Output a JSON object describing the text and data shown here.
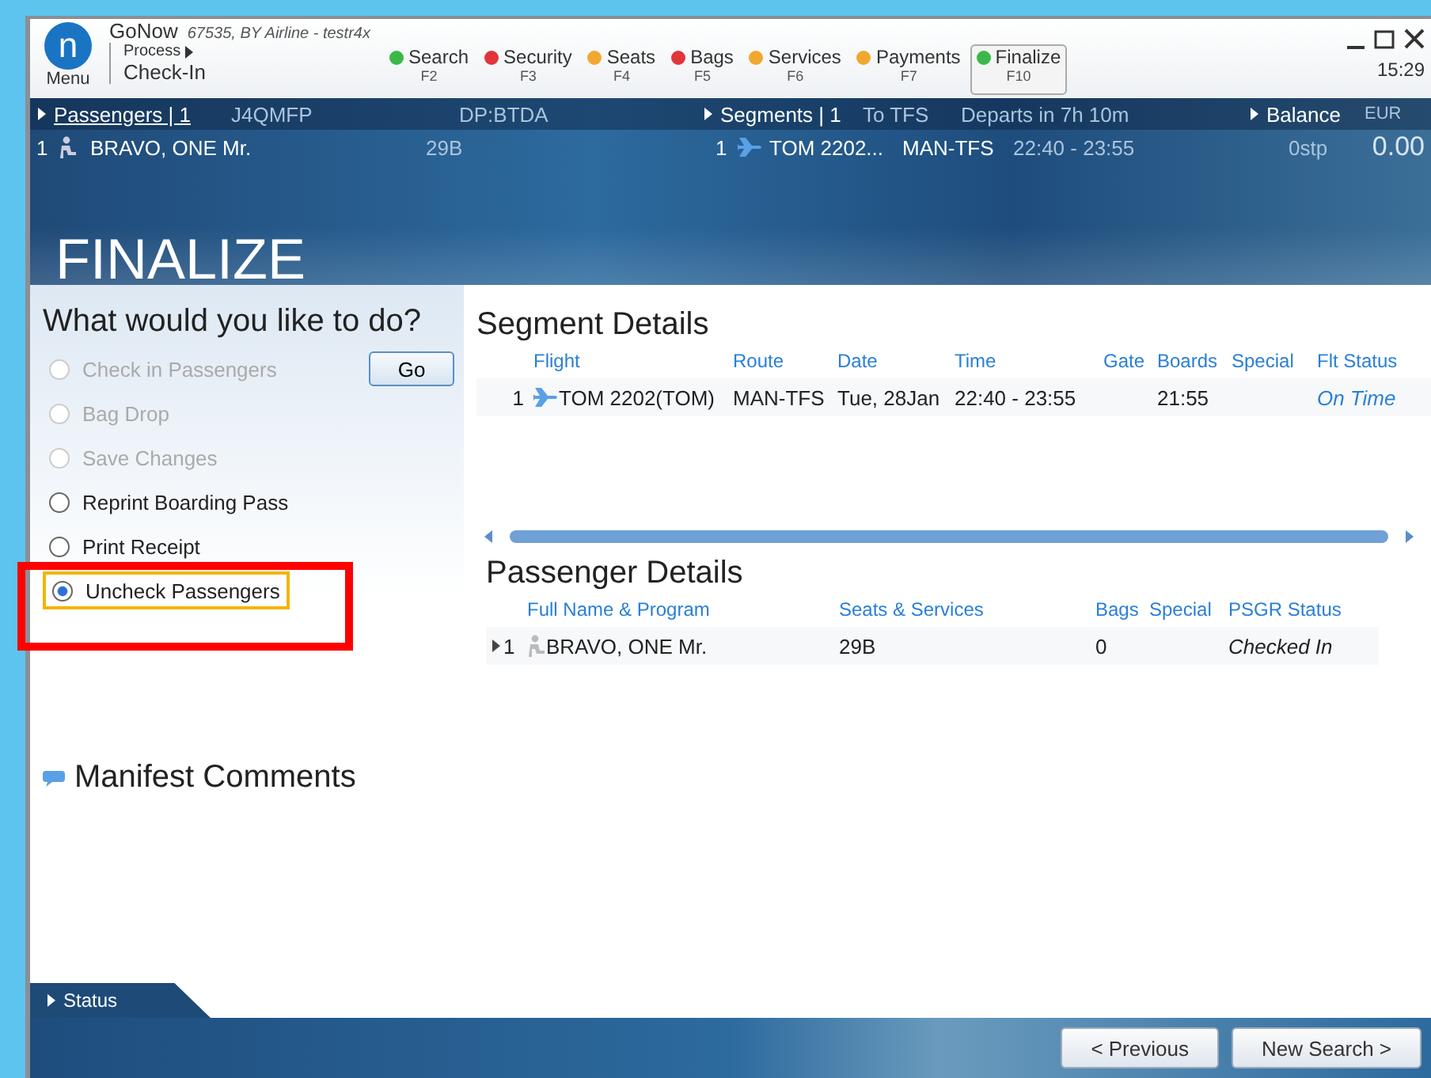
{
  "app": {
    "logo": "n",
    "menu": "Menu",
    "title": "GoNow",
    "subtitle": "67535, BY Airline - testr4x",
    "process": "Process",
    "mode": "Check-In",
    "time": "15:29"
  },
  "steps": [
    {
      "label": "Search",
      "key": "F2",
      "color": "#3cb84a",
      "selected": false
    },
    {
      "label": "Security",
      "key": "F3",
      "color": "#e0353b",
      "selected": false
    },
    {
      "label": "Seats",
      "key": "F4",
      "color": "#f0a830",
      "selected": false
    },
    {
      "label": "Bags",
      "key": "F5",
      "color": "#e0353b",
      "selected": false
    },
    {
      "label": "Services",
      "key": "F6",
      "color": "#f0a830",
      "selected": false
    },
    {
      "label": "Payments",
      "key": "F7",
      "color": "#f0a830",
      "selected": false
    },
    {
      "label": "Finalize",
      "key": "F10",
      "color": "#3cb84a",
      "selected": true
    }
  ],
  "passengers": {
    "label": "Passengers | 1",
    "pnr": "J4QMFP",
    "dp": "DP:BTDA",
    "row": {
      "index": "1",
      "name": "BRAVO, ONE Mr.",
      "seat": "29B"
    }
  },
  "segments": {
    "label": "Segments | 1",
    "dest": "To TFS",
    "departs": "Departs in 7h 10m",
    "row": {
      "index": "1",
      "flight": "TOM 2202...",
      "route": "MAN-TFS",
      "time": "22:40 - 23:55",
      "stops": "0stp"
    }
  },
  "balance": {
    "label": "Balance",
    "currency": "EUR",
    "amount": "0.00"
  },
  "page_title": "FINALIZE",
  "actions": {
    "question": "What would you like to do?",
    "go": "Go",
    "options": [
      {
        "label": "Check in Passengers",
        "disabled": true,
        "selected": false
      },
      {
        "label": "Bag Drop",
        "disabled": true,
        "selected": false
      },
      {
        "label": "Save Changes",
        "disabled": true,
        "selected": false
      },
      {
        "label": "Reprint Boarding Pass",
        "disabled": false,
        "selected": false
      },
      {
        "label": "Print Receipt",
        "disabled": false,
        "selected": false
      },
      {
        "label": "Uncheck Passengers",
        "disabled": false,
        "selected": true
      }
    ]
  },
  "segment_details": {
    "title": "Segment Details",
    "columns": [
      "",
      "Flight",
      "Route",
      "Date",
      "Time",
      "Gate",
      "Boards",
      "Special",
      "Flt Status"
    ],
    "rows": [
      [
        "1",
        "TOM 2202(TOM)",
        "MAN-TFS",
        "Tue, 28Jan",
        "22:40 - 23:55",
        "",
        "21:55",
        "",
        "On Time"
      ]
    ]
  },
  "passenger_details": {
    "title": "Passenger Details",
    "columns": [
      "",
      "Full Name & Program",
      "Seats & Services",
      "Bags",
      "Special",
      "PSGR Status"
    ],
    "rows": [
      [
        "1",
        "BRAVO, ONE Mr.",
        "29B",
        "0",
        "",
        "Checked In"
      ]
    ]
  },
  "manifest": "Manifest Comments",
  "status": "Status",
  "buttons": [
    "< Previous",
    "New Search >"
  ]
}
